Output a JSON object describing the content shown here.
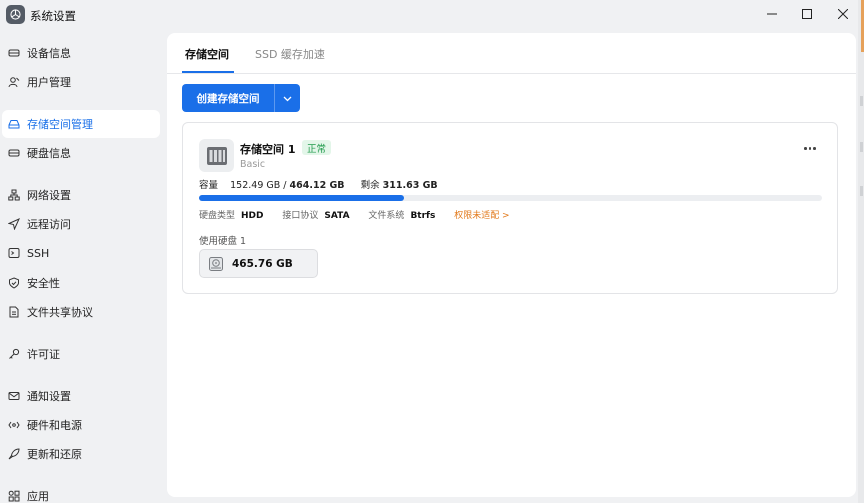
{
  "window": {
    "title": "系统设置",
    "controls": {
      "minimize": "minimize-icon",
      "maximize": "maximize-icon",
      "close": "close-icon"
    }
  },
  "sidebar": {
    "items": [
      {
        "label": "设备信息",
        "icon": "device-icon",
        "active": false
      },
      {
        "label": "用户管理",
        "icon": "user-icon",
        "active": false
      },
      {
        "label": "存储空间管理",
        "icon": "storage-icon",
        "active": true
      },
      {
        "label": "硬盘信息",
        "icon": "disk-icon",
        "active": false
      },
      {
        "label": "网络设置",
        "icon": "network-icon",
        "active": false
      },
      {
        "label": "远程访问",
        "icon": "send-icon",
        "active": false
      },
      {
        "label": "SSH",
        "icon": "terminal-icon",
        "active": false
      },
      {
        "label": "安全性",
        "icon": "shield-icon",
        "active": false
      },
      {
        "label": "文件共享协议",
        "icon": "file-icon",
        "active": false
      },
      {
        "label": "许可证",
        "icon": "key-icon",
        "active": false
      },
      {
        "label": "通知设置",
        "icon": "mail-icon",
        "active": false
      },
      {
        "label": "硬件和电源",
        "icon": "hardware-icon",
        "active": false
      },
      {
        "label": "更新和还原",
        "icon": "rocket-icon",
        "active": false
      },
      {
        "label": "应用",
        "icon": "apps-icon",
        "active": false
      }
    ]
  },
  "tabs": [
    {
      "label": "存储空间",
      "active": true
    },
    {
      "label": "SSD 缓存加速",
      "active": false
    }
  ],
  "toolbar": {
    "create_label": "创建存储空间",
    "dropdown_icon": "chevron-down-icon"
  },
  "pool": {
    "name": "存储空间 1",
    "status": "正常",
    "type": "Basic",
    "capacity_label": "容量",
    "used": "152.49 GB",
    "separator": "/",
    "total": "464.12 GB",
    "remaining_label": "剩余",
    "remaining": "311.63 GB",
    "usage_fraction": 0.3286,
    "disk_type_label": "硬盘类型",
    "disk_type": "HDD",
    "interface_label": "接口协议",
    "interface": "SATA",
    "fs_label": "文件系统",
    "fs": "Btrfs",
    "permission_text": "权限未适配 >",
    "disks_label": "使用硬盘 1",
    "disks": [
      {
        "size": "465.76 GB"
      }
    ]
  },
  "colors": {
    "accent": "#1a6fe8",
    "status_green": "#1f9a4b",
    "warning": "#e27a1c"
  }
}
